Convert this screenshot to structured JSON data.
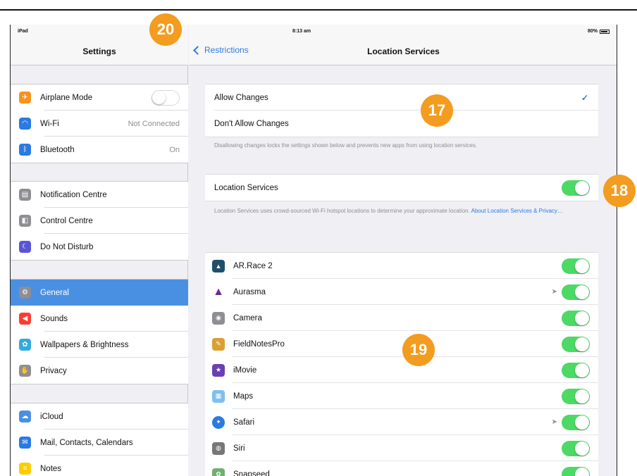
{
  "status_bar": {
    "carrier": "iPad",
    "time": "8:13 am",
    "battery": "80%"
  },
  "left_pane": {
    "title": "Settings",
    "groups": [
      [
        {
          "label": "Airplane Mode",
          "icon": "airplane-icon",
          "color": "#f7931e",
          "control": "toggle-off"
        },
        {
          "label": "Wi-Fi",
          "icon": "wifi-icon",
          "color": "#2a7ae2",
          "value": "Not Connected"
        },
        {
          "label": "Bluetooth",
          "icon": "bluetooth-icon",
          "color": "#2a7ae2",
          "value": "On"
        }
      ],
      [
        {
          "label": "Notification Centre",
          "icon": "notification-icon",
          "color": "#8e8e93"
        },
        {
          "label": "Control Centre",
          "icon": "control-centre-icon",
          "color": "#8e8e93"
        },
        {
          "label": "Do Not Disturb",
          "icon": "moon-icon",
          "color": "#5856d6"
        }
      ],
      [
        {
          "label": "General",
          "icon": "gear-icon",
          "color": "#8e8e93",
          "selected": true
        },
        {
          "label": "Sounds",
          "icon": "speaker-icon",
          "color": "#ff3b30"
        },
        {
          "label": "Wallpapers & Brightness",
          "icon": "flower-icon",
          "color": "#34aadc"
        },
        {
          "label": "Privacy",
          "icon": "hand-icon",
          "color": "#8e8e93"
        }
      ],
      [
        {
          "label": "iCloud",
          "icon": "cloud-icon",
          "color": "#4a90e2"
        },
        {
          "label": "Mail, Contacts, Calendars",
          "icon": "mail-icon",
          "color": "#2a7ae2"
        },
        {
          "label": "Notes",
          "icon": "notes-icon",
          "color": "#ffcc00"
        }
      ]
    ]
  },
  "right_pane": {
    "back_label": "Restrictions",
    "title": "Location Services",
    "allow_group": [
      {
        "label": "Allow Changes",
        "checked": true
      },
      {
        "label": "Don't Allow Changes",
        "checked": false
      }
    ],
    "allow_footnote": "Disallowing changes locks the settings shown below and prevents new apps from using location services.",
    "location_services_label": "Location Services",
    "location_services_on": true,
    "location_footnote": "Location Services uses crowd-sourced Wi-Fi hotspot locations to determine your approximate location.",
    "location_footnote_link": "About Location Services & Privacy…",
    "apps": [
      {
        "name": "AR.Race 2",
        "icon": "ar-race-icon",
        "color": "#1f4f6b",
        "on": true,
        "arrow": false
      },
      {
        "name": "Aurasma",
        "icon": "aurasma-icon",
        "color": "#6a2c91",
        "on": true,
        "arrow": true
      },
      {
        "name": "Camera",
        "icon": "camera-icon",
        "color": "#8e8e93",
        "on": true,
        "arrow": false
      },
      {
        "name": "FieldNotesPro",
        "icon": "fieldnotes-icon",
        "color": "#d9a032",
        "on": true,
        "arrow": false
      },
      {
        "name": "iMovie",
        "icon": "imovie-icon",
        "color": "#6a3fb5",
        "on": true,
        "arrow": false
      },
      {
        "name": "Maps",
        "icon": "maps-icon",
        "color": "#7ec0ee",
        "on": true,
        "arrow": false
      },
      {
        "name": "Safari",
        "icon": "compass-icon",
        "color": "#2a7ae2",
        "on": true,
        "arrow": true
      },
      {
        "name": "Siri",
        "icon": "microphone-icon",
        "color": "#777777",
        "on": true,
        "arrow": false
      },
      {
        "name": "Snapseed",
        "icon": "snapseed-icon",
        "color": "#6fb06f",
        "on": true,
        "arrow": false
      }
    ]
  },
  "badges": [
    "20",
    "17",
    "18",
    "19"
  ],
  "colors": {
    "accent": "#2a7ae2",
    "toggle_on": "#4cd964",
    "selected": "#4a90e2",
    "badge": "#f39c1f"
  }
}
